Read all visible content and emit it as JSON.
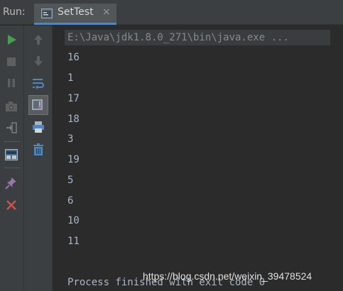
{
  "header": {
    "run_label": "Run:",
    "tab_label": "SetTest",
    "tab_close": "×"
  },
  "toolbar": {
    "left_icons": [
      "run-icon",
      "stop-icon",
      "pause-icon",
      "camera-icon",
      "exit-icon",
      "layout-icon",
      "pin-icon",
      "close-icon"
    ],
    "right_icons": [
      "up-arrow-icon",
      "down-arrow-icon",
      "soft-wrap-icon",
      "scroll-to-end-icon",
      "print-icon",
      "trash-icon"
    ]
  },
  "console": {
    "command": "E:\\Java\\jdk1.8.0_271\\bin\\java.exe ...",
    "output": [
      "16",
      "1",
      "17",
      "18",
      "3",
      "19",
      "5",
      "6",
      "10",
      "11"
    ],
    "finish_message": "Process finished with exit code 0"
  },
  "watermark": "https://blog.csdn.net/weixin_39478524",
  "colors": {
    "accent": "#4a88c7",
    "run_green": "#499c54",
    "close_red": "#c75450",
    "console_text": "#a9b7c6"
  }
}
